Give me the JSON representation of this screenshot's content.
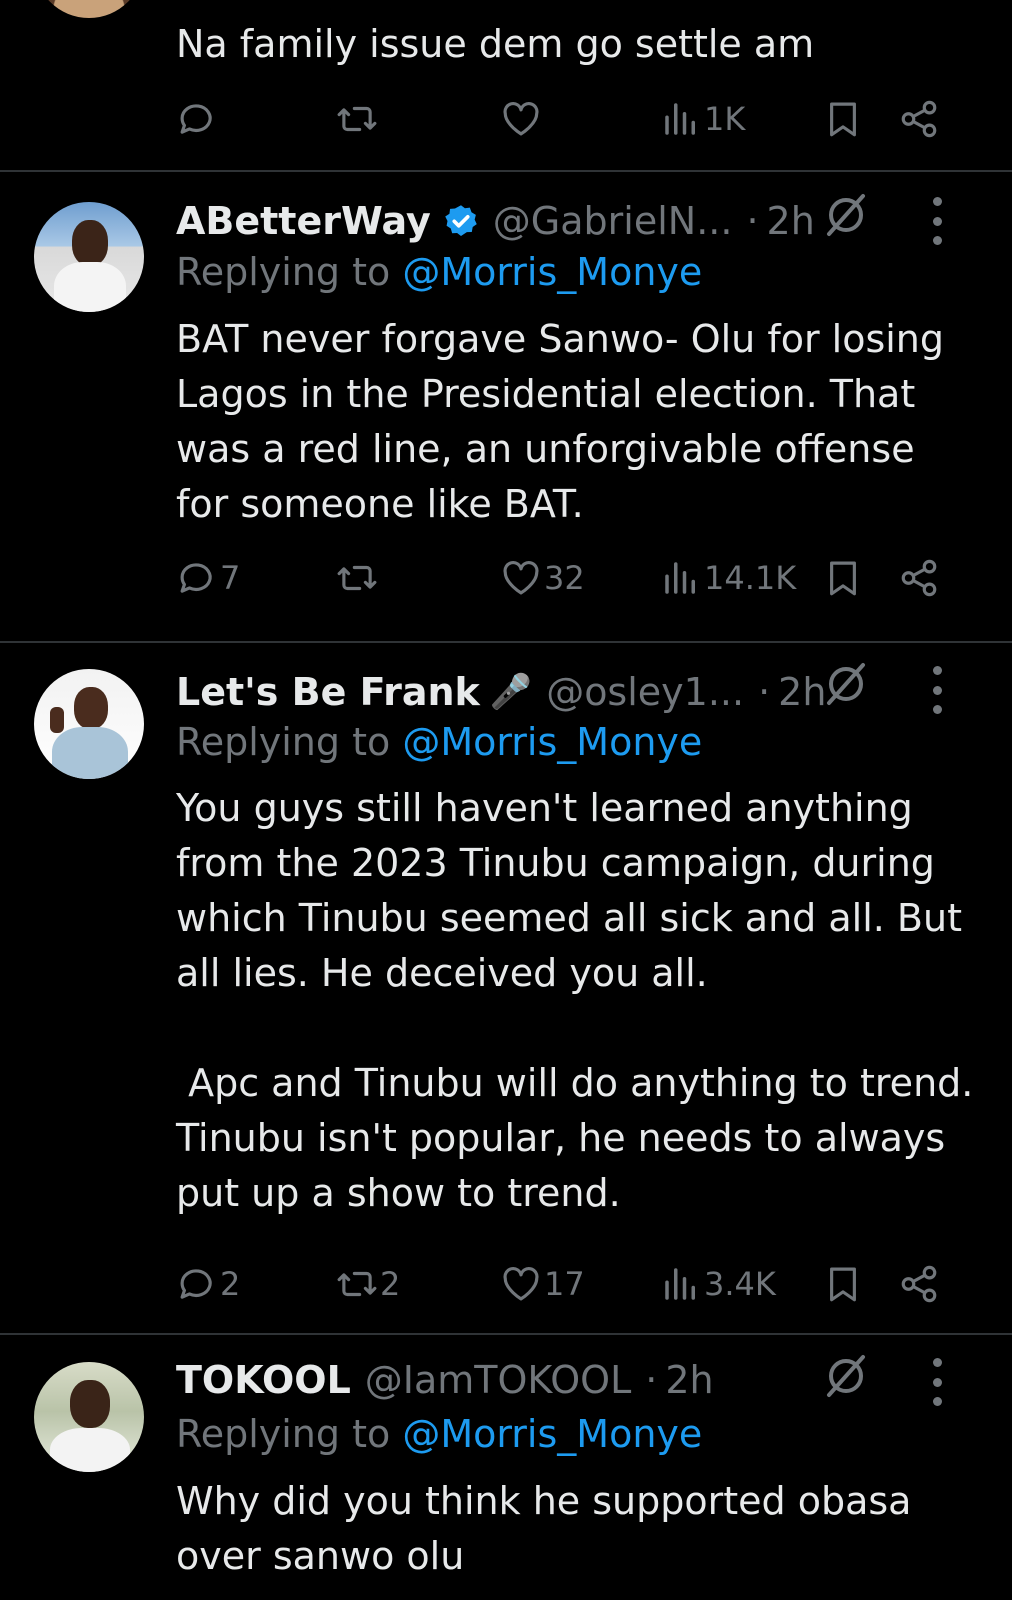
{
  "replies": [
    {
      "text": "Na family issue dem go settle am",
      "actions": {
        "replies": "",
        "reposts": "",
        "likes": "",
        "views": "1K"
      }
    },
    {
      "name": "ABetterWay",
      "verified": true,
      "handle": "@GabrielN...",
      "dot": "·",
      "time": "2h",
      "replying_prefix": "Replying to ",
      "mention": "@Morris_Monye",
      "text": "BAT never forgave Sanwo- Olu for losing Lagos in the Presidential election. That was a red line, an unforgivable offense for someone like BAT.",
      "actions": {
        "replies": "7",
        "reposts": "",
        "likes": "32",
        "views": "14.1K"
      }
    },
    {
      "name": "Let's Be Frank",
      "emoji": "🎤",
      "handle": "@osley1...",
      "dot": "·",
      "time": "2h",
      "replying_prefix": "Replying to ",
      "mention": "@Morris_Monye",
      "text": "You guys still haven't learned anything from the 2023 Tinubu campaign, during which Tinubu seemed all sick and all. But all lies. He deceived you all.\n\n Apc and Tinubu will do anything to trend. Tinubu isn't popular, he needs to always put up a show to trend.",
      "actions": {
        "replies": "2",
        "reposts": "2",
        "likes": "17",
        "views": "3.4K"
      }
    },
    {
      "name": "TOKOOL",
      "handle": "@IamTOKOOL",
      "dot": "·",
      "time": "2h",
      "replying_prefix": "Replying to ",
      "mention": "@Morris_Monye",
      "text": "Why did you think he supported obasa over sanwo olu"
    }
  ],
  "icons": {
    "reply": "reply-icon",
    "repost": "repost-icon",
    "like": "heart-icon",
    "views": "views-icon",
    "bookmark": "bookmark-icon",
    "share": "share-icon",
    "grok": "grok-icon",
    "more": "more-icon",
    "verified": "verified-badge-icon"
  },
  "colors": {
    "background": "#000000",
    "text": "#e7e9ea",
    "muted": "#71767b",
    "link": "#1d9bf0",
    "divider": "#2f3336"
  }
}
